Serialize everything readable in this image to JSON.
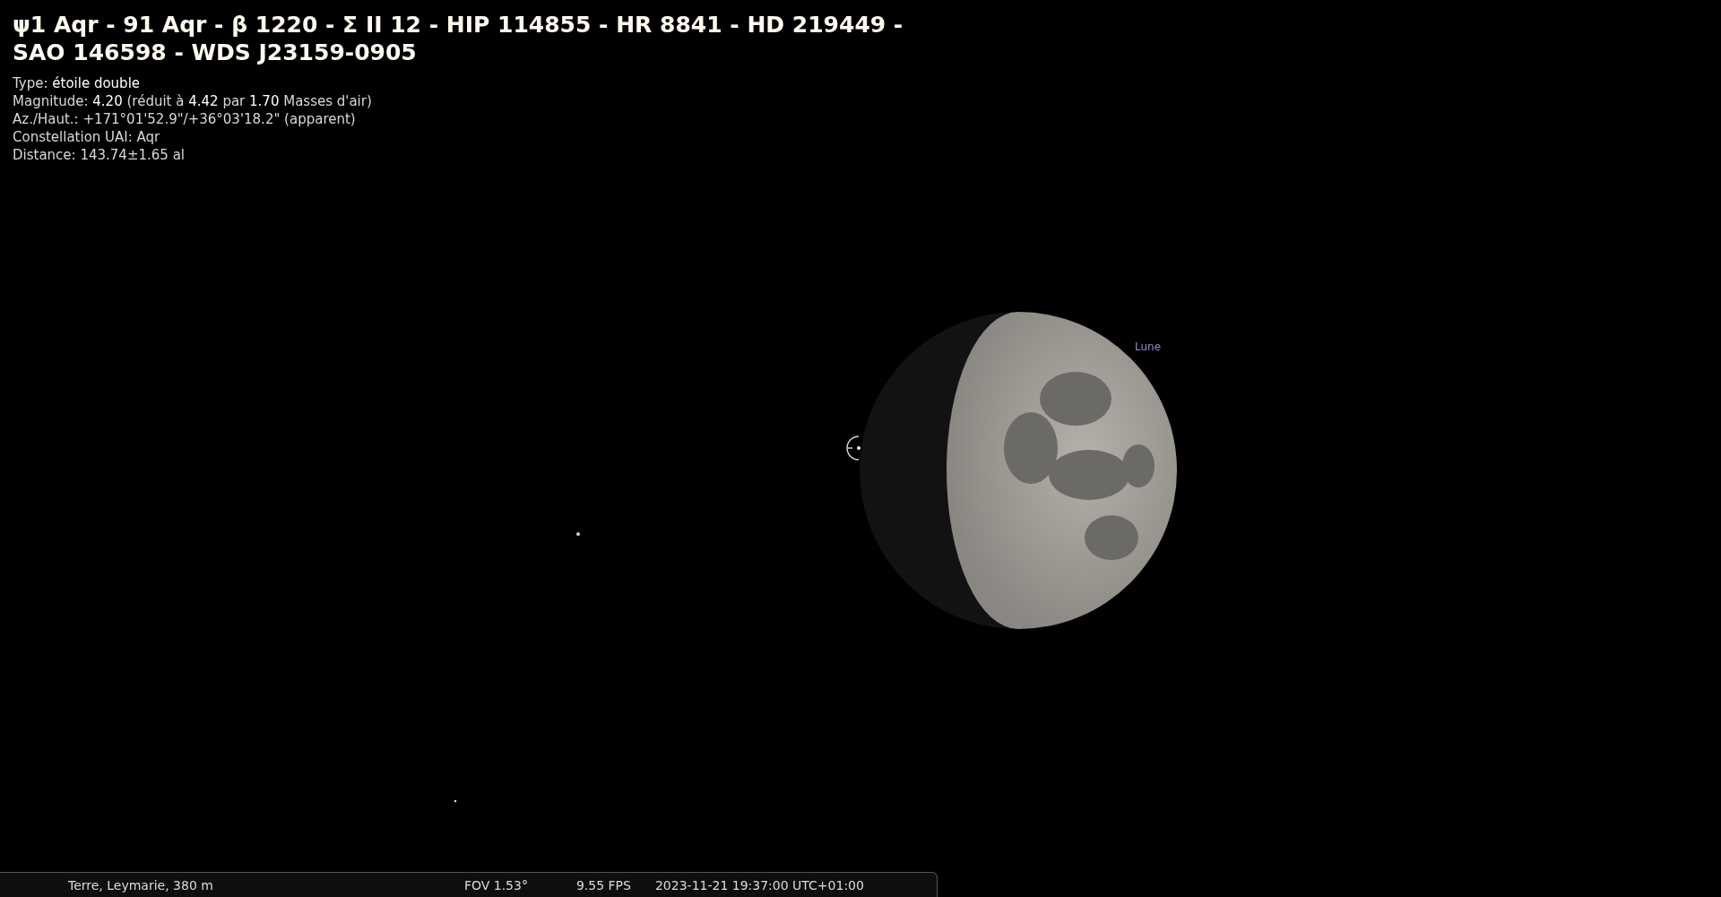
{
  "object_info": {
    "title": "ψ1 Aqr - 91 Aqr - β 1220 - Σ II 12 - HIP 114855 - HR 8841 - HD 219449 - SAO 146598 - WDS J23159-0905",
    "lines": [
      "Type: **étoile double**",
      "Magnitude: **4.20** (réduit à **4.42** par **1.70** Masses d'air)",
      "Az./Haut.: +171°01'52.9\"/+36°03'18.2\" (apparent)",
      "Constellation UAI: Aqr",
      "Distance: 143.74±1.65 al"
    ]
  },
  "sky": {
    "moon_label": "Lune"
  },
  "status_bar": {
    "location": "Terre, Leymarie, 380 m",
    "fov": "FOV 1.53°",
    "fps": "9.55 FPS",
    "datetime": "2023-11-21 19:37:00 UTC+01:00"
  }
}
